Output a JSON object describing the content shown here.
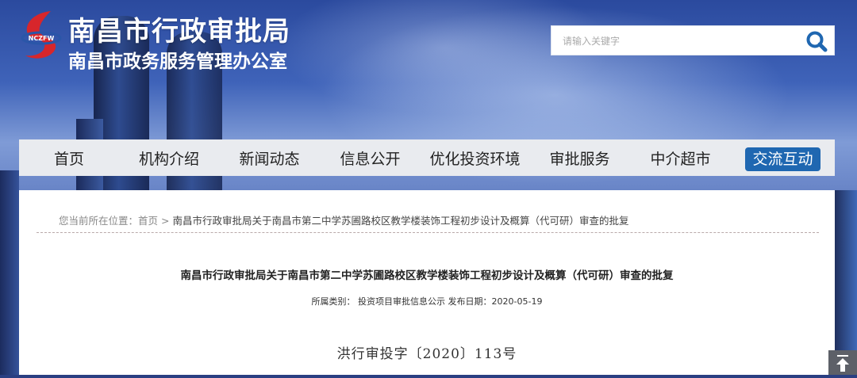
{
  "header": {
    "title": "南昌市行政审批局",
    "subtitle": "南昌市政务服务管理办公室",
    "logo_icon": "nczfw-logo"
  },
  "search": {
    "placeholder": "请输入关键字",
    "button_icon": "search-icon"
  },
  "nav": {
    "items": [
      {
        "label": "首页"
      },
      {
        "label": "机构介绍"
      },
      {
        "label": "新闻动态"
      },
      {
        "label": "信息公开"
      },
      {
        "label": "优化投资环境"
      },
      {
        "label": "审批服务"
      },
      {
        "label": "中介超市"
      },
      {
        "label": "交流互动"
      }
    ],
    "active_color": "#1f67b1"
  },
  "breadcrumb": {
    "prefix": "您当前所在位置：",
    "home": "首页",
    "separator": ">",
    "current": "南昌市行政审批局关于南昌市第二中学苏圃路校区教学楼装饰工程初步设计及概算（代可研）审查的批复"
  },
  "article": {
    "title": "南昌市行政审批局关于南昌市第二中学苏圃路校区教学楼装饰工程初步设计及概算（代可研）审查的批复",
    "category_label": "所属类别：",
    "category": "投资项目审批信息公示",
    "date_label": "发布日期：",
    "date": "2020-05-19",
    "doc_number": "洪行审投字〔2020〕113号"
  },
  "back_to_top_icon": "arrow-up-icon"
}
